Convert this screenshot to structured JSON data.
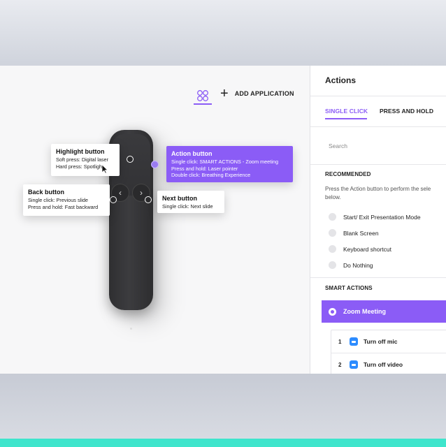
{
  "toolbar": {
    "add_application_label": "ADD APPLICATION"
  },
  "callouts": {
    "highlight": {
      "title": "Highlight button",
      "lines": [
        "Soft press: Digital laser",
        "Hard press: Spotlight"
      ]
    },
    "action": {
      "title": "Action button",
      "lines": [
        "Single click: SMART ACTIONS - Zoom meeting",
        "Press and hold: Laser pointer",
        "Double click: Breathing Experience"
      ]
    },
    "back": {
      "title": "Back button",
      "lines": [
        "Single click: Previous slide",
        "Press and hold: Fast backward"
      ]
    },
    "next": {
      "title": "Next button",
      "lines": [
        "Single click: Next slide"
      ]
    }
  },
  "remote": {
    "prev_glyph": "‹",
    "next_glyph": "›"
  },
  "panel": {
    "title": "Actions",
    "tabs": [
      "SINGLE CLICK",
      "PRESS AND HOLD"
    ],
    "active_tab": "SINGLE CLICK",
    "search_placeholder": "Search",
    "recommended": {
      "heading": "RECOMMENDED",
      "description_lines": [
        "Press the Action button to perform the sele",
        "below."
      ],
      "options": [
        "Start/ Exit Presentation Mode",
        "Blank Screen",
        "Keyboard shortcut",
        "Do Nothing"
      ]
    },
    "smart_actions": {
      "heading": "SMART ACTIONS",
      "selected": "Zoom Meeting",
      "steps": [
        {
          "num": "1",
          "label": "Turn off mic"
        },
        {
          "num": "2",
          "label": "Turn off video"
        }
      ]
    }
  },
  "colors": {
    "accent": "#8b5cf6",
    "teal": "#3fe5cc",
    "zoom_blue": "#2d8cff"
  }
}
